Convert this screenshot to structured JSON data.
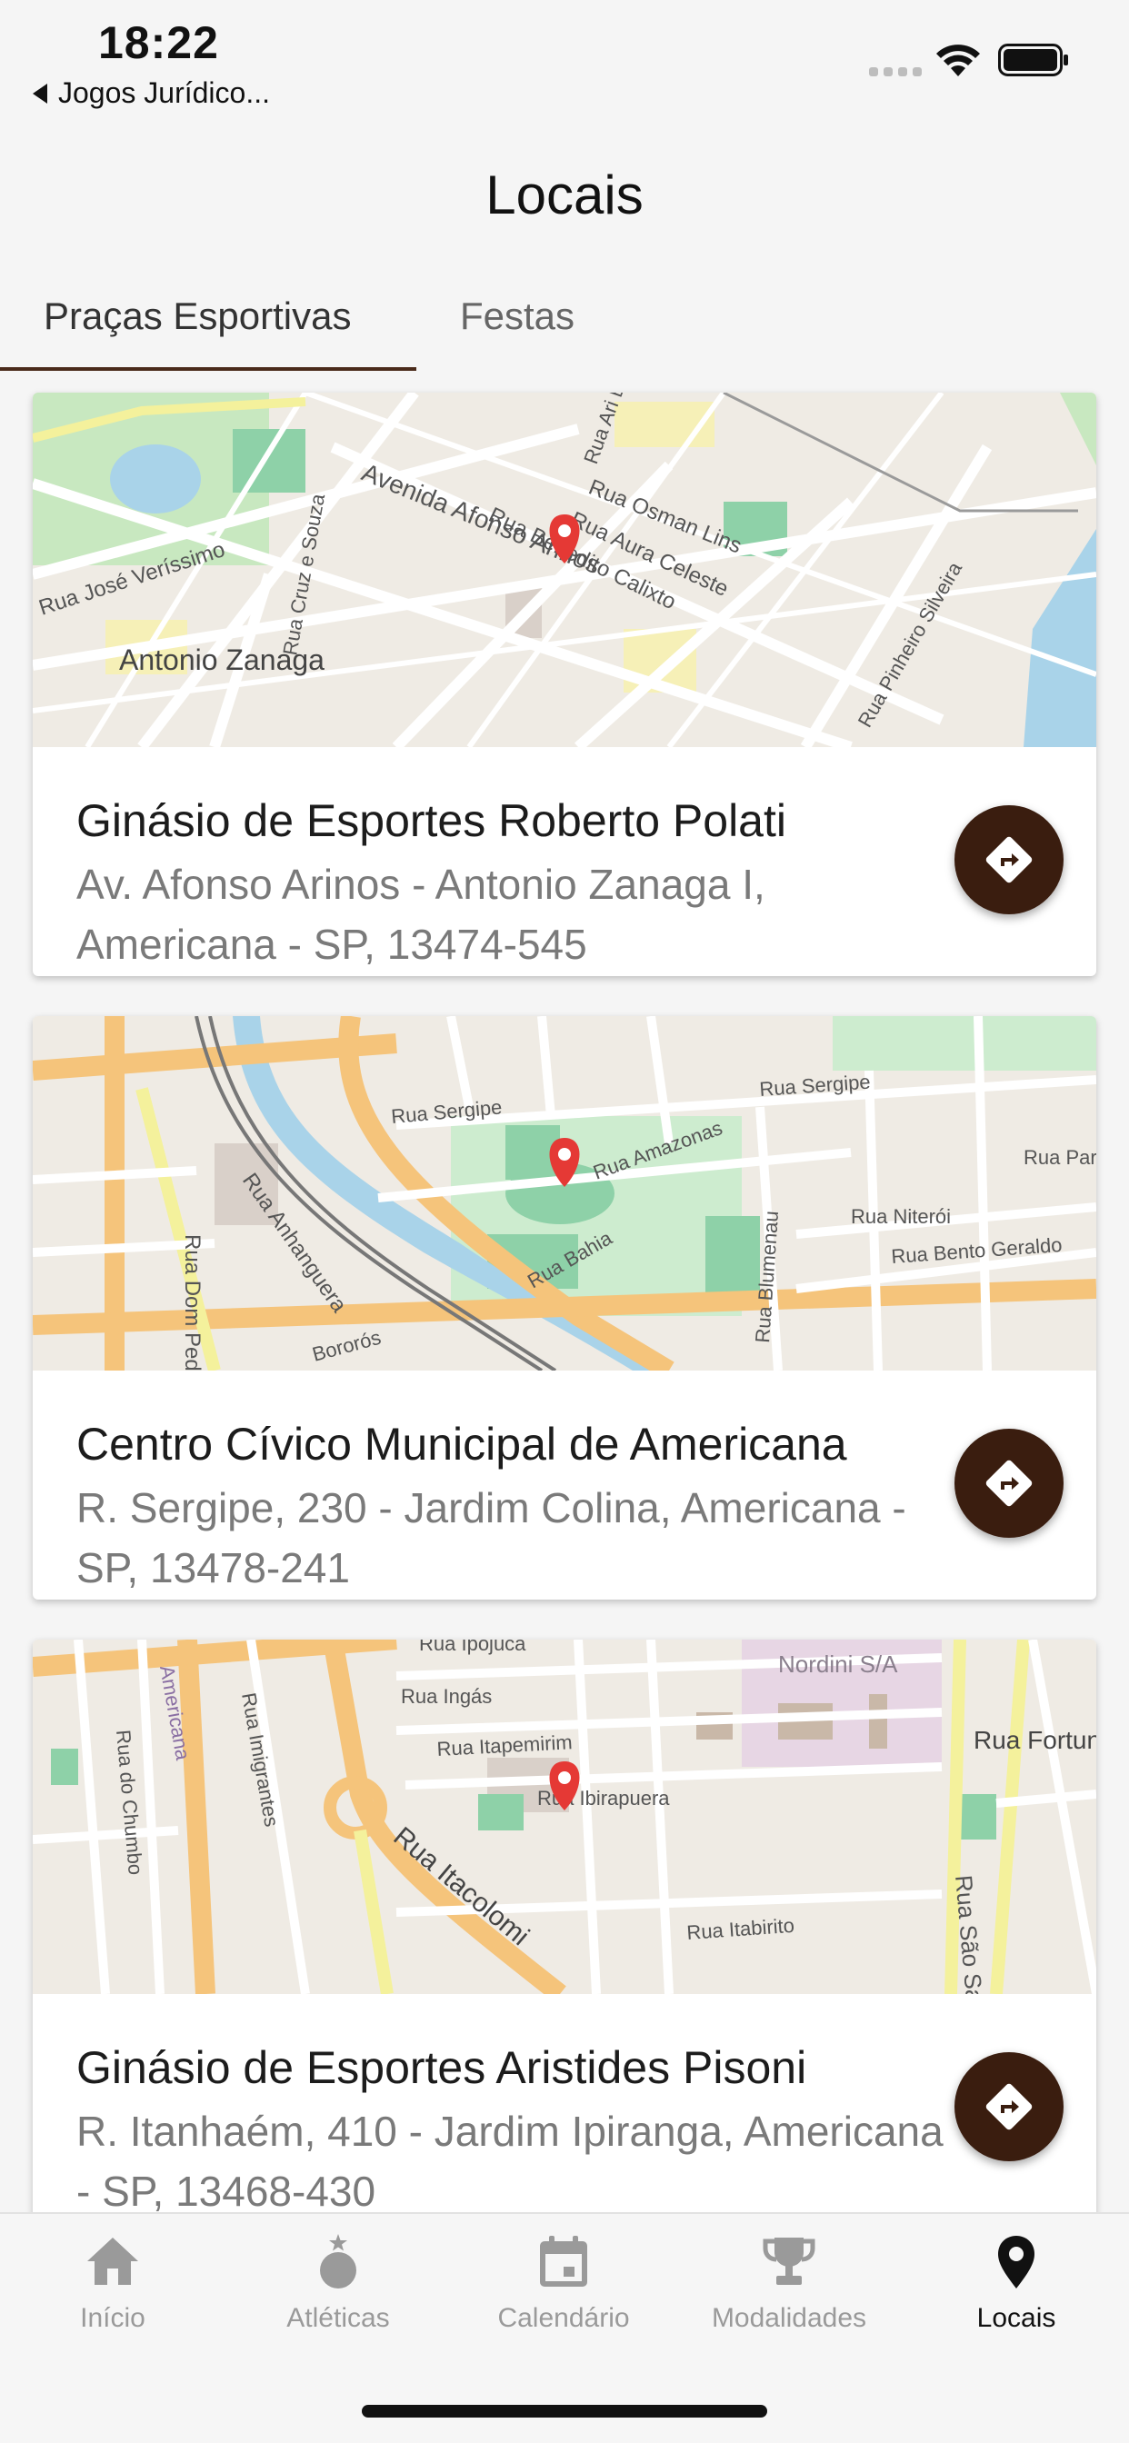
{
  "status_bar": {
    "time": "18:22",
    "back_app": "Jogos Jurídico..."
  },
  "header": {
    "title": "Locais"
  },
  "tabs": [
    {
      "label": "Praças Esportivas",
      "active": true
    },
    {
      "label": "Festas",
      "active": false
    }
  ],
  "places": [
    {
      "name": "Ginásio de Esportes Roberto Polati",
      "address": "Av. Afonso Arinos - Antonio Zanaga I, Americana - SP, 13474-545",
      "map_labels": [
        "Avenida Afonso Arinos",
        "Rua Benedito Calixto",
        "Rua Osman Lins",
        "Rua Aura Celeste",
        "Rua José Veríssimo",
        "Antonio Zanaga",
        "Rua Cruz e Souza",
        "Rua Ari Barroso",
        "Rua Pinheiro Silveira"
      ]
    },
    {
      "name": "Centro Cívico Municipal de Americana",
      "address": "R. Sergipe, 230 - Jardim Colina, Americana - SP, 13478-241",
      "map_labels": [
        "Rua Sergipe",
        "Rua Amazonas",
        "Rua Anhanguera",
        "Rua Dom Pedro",
        "Rua Bahia",
        "Rua Blumenau",
        "Rua Niterói",
        "Rua Bento Geraldo",
        "Rua Parati",
        "Bororós"
      ]
    },
    {
      "name": "Ginásio de Esportes Aristides Pisoni",
      "address": "R. Itanhaém, 410 - Jardim Ipiranga, Americana - SP, 13468-430",
      "map_labels": [
        "Rua Ipojuca",
        "Rua Ingás",
        "Rua Itapemirim",
        "Rua Ibirapuera",
        "Rua Itacolomi",
        "Rua Itabirito",
        "Americana",
        "Nordini S/A",
        "Rua Imigrantes",
        "Rua do Chumbo",
        "Rua Fortuna",
        "Rua São Sabino"
      ]
    }
  ],
  "tabbar": [
    {
      "label": "Início",
      "icon": "home-icon",
      "active": false
    },
    {
      "label": "Atléticas",
      "icon": "medal-icon",
      "active": false
    },
    {
      "label": "Calendário",
      "icon": "calendar-icon",
      "active": false
    },
    {
      "label": "Modalidades",
      "icon": "trophy-icon",
      "active": false
    },
    {
      "label": "Locais",
      "icon": "map-pin-icon",
      "active": true
    }
  ],
  "colors": {
    "accent": "#3a1d0f",
    "tab_underline": "#4a2a1a",
    "map_marker": "#e53935",
    "inactive_tab": "#9a9a9a"
  }
}
